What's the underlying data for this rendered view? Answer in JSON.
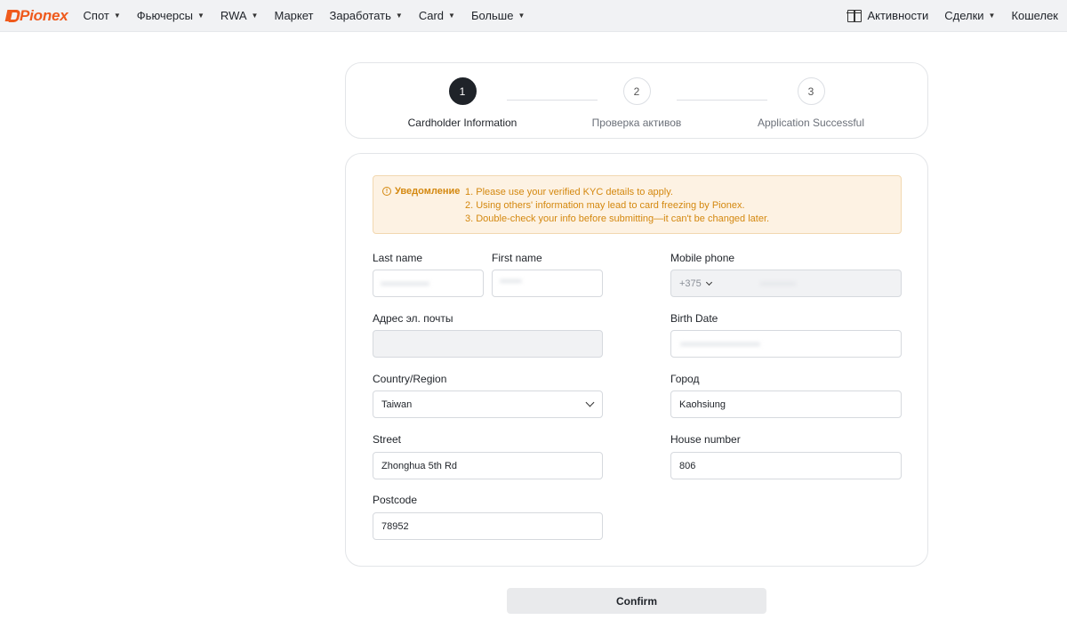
{
  "brand": {
    "name": "Pionex",
    "color": "#ef5a1c"
  },
  "nav": {
    "left": [
      {
        "label": "Спот",
        "dropdown": true
      },
      {
        "label": "Фьючерсы",
        "dropdown": true
      },
      {
        "label": "RWA",
        "dropdown": true
      },
      {
        "label": "Маркет",
        "dropdown": false
      },
      {
        "label": "Заработать",
        "dropdown": true
      },
      {
        "label": "Card",
        "dropdown": true
      },
      {
        "label": "Больше",
        "dropdown": true
      }
    ],
    "right": {
      "activities": {
        "label": "Активности",
        "icon": "gift-icon"
      },
      "trades": {
        "label": "Сделки",
        "dropdown": true
      },
      "wallet": {
        "label": "Кошелек",
        "dropdown": true
      }
    }
  },
  "steps": [
    {
      "number": "1",
      "label": "Cardholder Information",
      "active": true
    },
    {
      "number": "2",
      "label": "Проверка активов",
      "active": false
    },
    {
      "number": "3",
      "label": "Application Successful",
      "active": false
    }
  ],
  "notice": {
    "title": "Уведомление",
    "icon": "info-icon",
    "lines": [
      "1. Please use your verified KYC details to apply.",
      "2. Using others' information may lead to card freezing by Pionex.",
      "3. Double-check your info before submitting—it can't be changed later."
    ],
    "color": "#d4880f",
    "background": "#fdf2e3"
  },
  "form": {
    "last_name": {
      "label": "Last name",
      "value": ""
    },
    "first_name": {
      "label": "First name",
      "value": ""
    },
    "mobile_phone": {
      "label": "Mobile phone",
      "country_code": "+375",
      "value": ""
    },
    "email": {
      "label": "Адрес эл. почты",
      "value": ""
    },
    "birth_date": {
      "label": "Birth Date",
      "value": ""
    },
    "country": {
      "label": "Country/Region",
      "value": "Taiwan"
    },
    "city": {
      "label": "Город",
      "value": "Kaohsiung"
    },
    "street": {
      "label": "Street",
      "value": "Zhonghua 5th Rd"
    },
    "house_number": {
      "label": "House number",
      "value": "806"
    },
    "postcode": {
      "label": "Postcode",
      "value": "78952"
    }
  },
  "confirm_label": "Confirm"
}
